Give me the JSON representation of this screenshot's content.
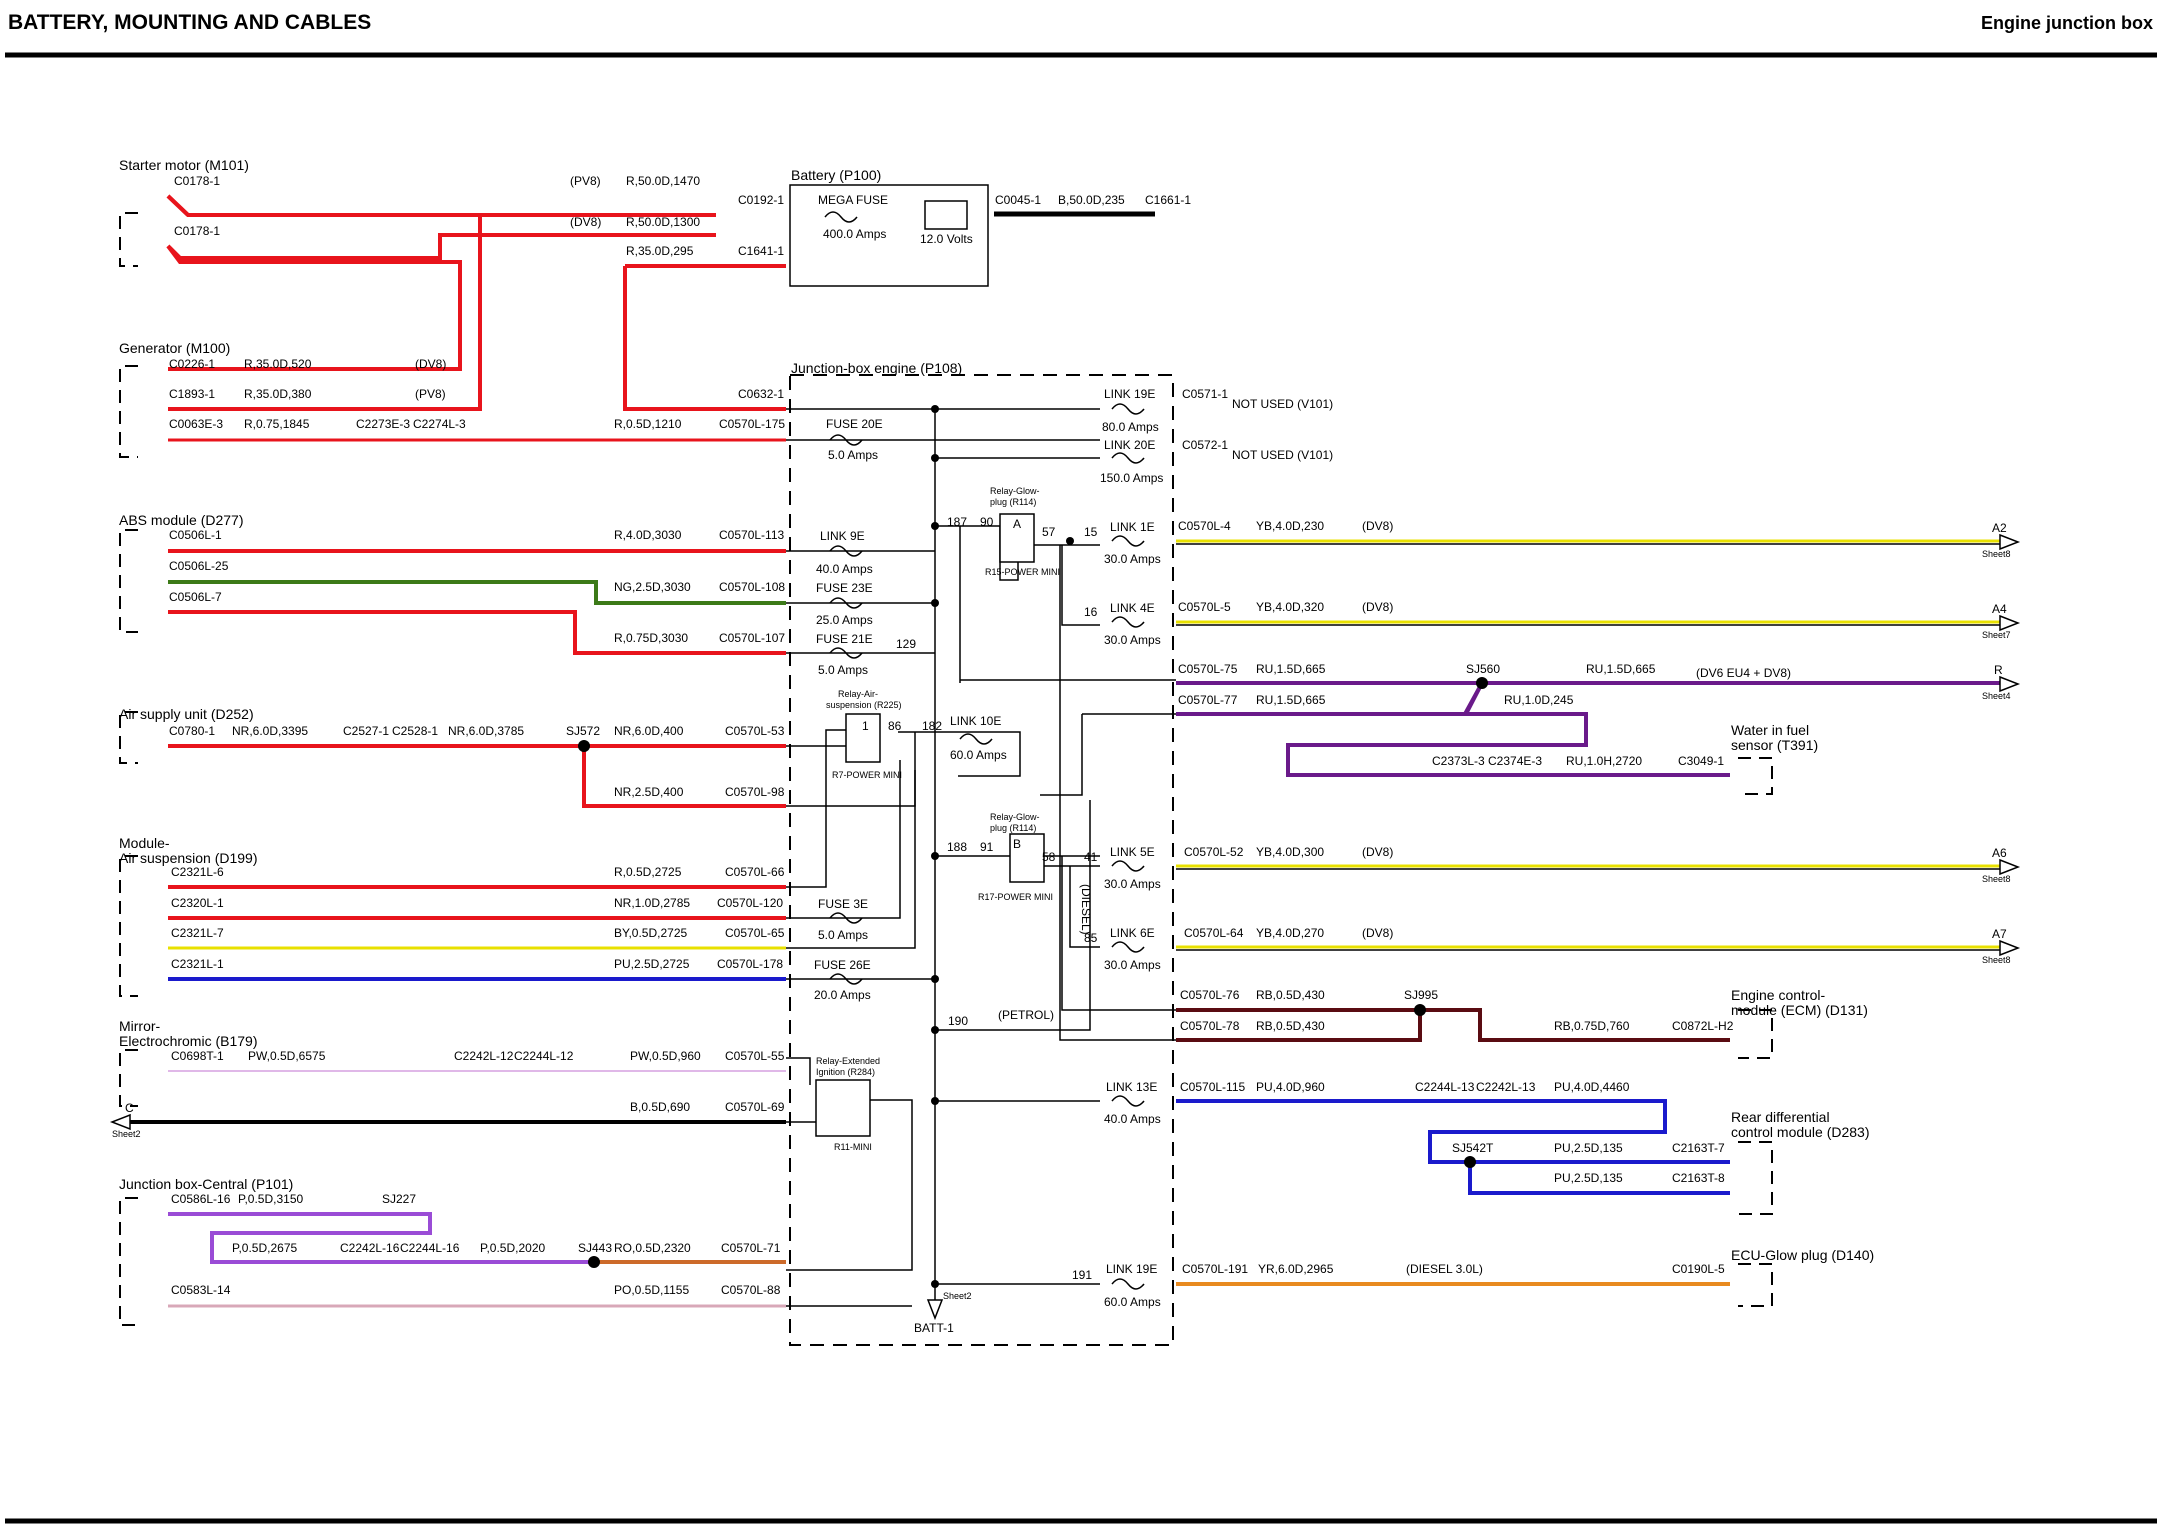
{
  "header": {
    "title": "BATTERY, MOUNTING AND CABLES",
    "subtitle": "Engine junction box"
  },
  "components": {
    "starter": "Starter motor (M101)",
    "generator": "Generator (M100)",
    "battery": "Battery (P100)",
    "jbox": "Junction-box engine (P108)",
    "abs": "ABS module (D277)",
    "air_supply": "Air supply unit (D252)",
    "module_air_1": "Module-",
    "module_air_2": "Air suspension (D199)",
    "mirror_1": "Mirror-",
    "mirror_2": "Electrochromic (B179)",
    "jb_central": "Junction box-Central (P101)",
    "water_1": "Water in fuel",
    "water_2": "sensor (T391)",
    "ecm_1": "Engine control-",
    "ecm_2": "module (ECM) (D131)",
    "rdiff_1": "Rear differential",
    "rdiff_2": "control module (D283)",
    "ecu_glow": "ECU-Glow plug (D140)"
  },
  "battery_box": {
    "fuse_label": "MEGA FUSE",
    "fuse_rating": "400.0 Amps",
    "voltage": "12.0 Volts"
  },
  "relays": {
    "glow_a_1": "Relay-Glow-",
    "glow_a_2": "plug (R114)",
    "glow_a_letter": "A",
    "glow_a_type": "R15-POWER MINI",
    "air_1": "Relay-Air-",
    "air_2": "suspension (R225)",
    "air_type": "R7-POWER MINI",
    "glow_b_1": "Relay-Glow-",
    "glow_b_2": "plug (R114)",
    "glow_b_letter": "B",
    "glow_b_type": "R17-POWER MINI",
    "ign_1": "Relay-Extended",
    "ign_2": "Ignition (R284)",
    "ign_type": "R11-MINI"
  },
  "fuses": {
    "link19e_a": {
      "name": "LINK 19E",
      "rating": "80.0 Amps"
    },
    "link20e": {
      "name": "LINK 20E",
      "rating": "150.0 Amps"
    },
    "fuse20e": {
      "name": "FUSE 20E",
      "rating": "5.0 Amps"
    },
    "link9e": {
      "name": "LINK 9E",
      "rating": "40.0 Amps"
    },
    "fuse23e": {
      "name": "FUSE 23E",
      "rating": "25.0 Amps"
    },
    "fuse21e": {
      "name": "FUSE 21E",
      "rating": "5.0 Amps"
    },
    "link1e": {
      "name": "LINK 1E",
      "rating": "30.0 Amps"
    },
    "link4e": {
      "name": "LINK 4E",
      "rating": "30.0 Amps"
    },
    "link10e": {
      "name": "LINK 10E",
      "rating": "60.0 Amps"
    },
    "link5e": {
      "name": "LINK 5E",
      "rating": "30.0 Amps"
    },
    "link6e": {
      "name": "LINK 6E",
      "rating": "30.0 Amps"
    },
    "fuse3e": {
      "name": "FUSE 3E",
      "rating": "5.0 Amps"
    },
    "fuse26e": {
      "name": "FUSE 26E",
      "rating": "20.0 Amps"
    },
    "link13e": {
      "name": "LINK 13E",
      "rating": "40.0 Amps"
    },
    "link19e_b": {
      "name": "LINK 19E",
      "rating": "60.0 Amps"
    }
  },
  "connectors": {
    "c0178_1a": "C0178-1",
    "c0178_1b": "C0178-1",
    "c0192": "C0192-1",
    "c1641": "C1641-1",
    "c0045": "C0045-1",
    "c1661": "C1661-1",
    "c0226": "C0226-1",
    "c1893": "C1893-1",
    "c0063e": "C0063E-3",
    "c2273e": "C2273E-3",
    "c2274l": "C2274L-3",
    "c0632": "C0632-1",
    "c0570_175": "C0570L-175",
    "c0571": "C0571-1",
    "c0572": "C0572-1",
    "c0506_1": "C0506L-1",
    "c0506_25": "C0506L-25",
    "c0506_7": "C0506L-7",
    "c0570_113": "C0570L-113",
    "c0570_108": "C0570L-108",
    "c0570_107": "C0570L-107",
    "c0570_4": "C0570L-4",
    "c0570_5": "C0570L-5",
    "c0570_75": "C0570L-75",
    "c0570_77": "C0570L-77",
    "c0780": "C0780-1",
    "c2527": "C2527-1",
    "c2528": "C2528-1",
    "c0570_53": "C0570L-53",
    "c0570_98": "C0570L-98",
    "c2373l": "C2373L-3",
    "c2374e": "C2374E-3",
    "c3049": "C3049-1",
    "c2321_6": "C2321L-6",
    "c2320_1": "C2320L-1",
    "c2321_7": "C2321L-7",
    "c2321_1": "C2321L-1",
    "c0570_66": "C0570L-66",
    "c0570_120": "C0570L-120",
    "c0570_65": "C0570L-65",
    "c0570_178": "C0570L-178",
    "c0570_52": "C0570L-52",
    "c0570_64": "C0570L-64",
    "c0570_76": "C0570L-76",
    "c0570_78": "C0570L-78",
    "c0872": "C0872L-H2",
    "c0698t": "C0698T-1",
    "c2242l_12": "C2242L-12",
    "c2244l_12": "C2244L-12",
    "c0570_55": "C0570L-55",
    "c0570_69": "C0570L-69",
    "c0570_115": "C0570L-115",
    "c2244l_13": "C2244L-13",
    "c2242l_13": "C2242L-13",
    "c2163t_7": "C2163T-7",
    "c2163t_8": "C2163T-8",
    "c0586": "C0586L-16",
    "c2242l_16": "C2242L-16",
    "c2244l_16": "C2244L-16",
    "c0570_71": "C0570L-71",
    "c0583": "C0583L-14",
    "c0570_88": "C0570L-88",
    "c0570_191": "C0570L-191",
    "c0190": "C0190L-5"
  },
  "wires": {
    "w1": "R,50.0D,1470",
    "w2": "R,50.0D,1300",
    "w3": "R,35.0D,295",
    "w4": "B,50.0D,235",
    "w5": "R,35.0D,520",
    "w6": "R,35.0D,380",
    "w7": "R,0.75,1845",
    "w8": "R,0.5D,1210",
    "w9": "R,4.0D,3030",
    "w10": "NG,2.5D,3030",
    "w11": "R,0.75D,3030",
    "w12": "YB,4.0D,230",
    "w13": "YB,4.0D,320",
    "w14": "RU,1.5D,665",
    "w15": "RU,1.5D,665",
    "w16": "RU,1.5D,665",
    "w17": "RU,1.0D,245",
    "w18": "RU,1.0H,2720",
    "w19": "NR,6.0D,3395",
    "w20": "NR,6.0D,3785",
    "w21": "NR,6.0D,400",
    "w22": "NR,2.5D,400",
    "w23": "R,0.5D,2725",
    "w24": "NR,1.0D,2785",
    "w25": "BY,0.5D,2725",
    "w26": "PU,2.5D,2725",
    "w27": "YB,4.0D,300",
    "w28": "YB,4.0D,270",
    "w29": "RB,0.5D,430",
    "w30": "RB,0.5D,430",
    "w31": "RB,0.75D,760",
    "w32": "PW,0.5D,6575",
    "w33": "PW,0.5D,960",
    "w34": "B,0.5D,690",
    "w35": "PU,4.0D,960",
    "w36": "PU,4.0D,4460",
    "w37": "PU,2.5D,135",
    "w38": "PU,2.5D,135",
    "w39": "P,0.5D,3150",
    "w40": "P,0.5D,2675",
    "w41": "P,0.5D,2020",
    "w42": "RO,0.5D,2320",
    "w43": "PO,0.5D,1155",
    "w44": "YR,6.0D,2965"
  },
  "variants": {
    "pv8_a": "(PV8)",
    "dv8_a": "(DV8)",
    "dv8_b": "(DV8)",
    "pv8_b": "(PV8)",
    "dv8_c": "(DV8)",
    "dv8_d": "(DV8)",
    "dv6": "(DV6 EU4 + DV8)",
    "dv8_e": "(DV8)",
    "dv8_f": "(DV8)",
    "diesel": "(DIESEL)",
    "petrol": "(PETROL)",
    "diesel30": "(DIESEL 3.0L)"
  },
  "splices": {
    "sj560": "SJ560",
    "sj572": "SJ572",
    "sj995": "SJ995",
    "sj542t": "SJ542T",
    "sj227": "SJ227",
    "sj443": "SJ443"
  },
  "not_used": {
    "a": "NOT USED (V101)",
    "b": "NOT USED (V101)"
  },
  "nodes": {
    "n187": "187",
    "n90": "90",
    "n57": "57",
    "n15": "15",
    "n16": "16",
    "n129": "129",
    "n1": "1",
    "n86": "86",
    "n182": "182",
    "n188": "188",
    "n91": "91",
    "n58": "58",
    "n41": "41",
    "n85": "85",
    "n190": "190",
    "n191": "191"
  },
  "offpage": {
    "a2": "A2",
    "s8a": "Sheet8",
    "a4": "A4",
    "s7": "Sheet7",
    "r": "R",
    "s4": "Sheet4",
    "a6": "A6",
    "s8b": "Sheet8",
    "a7": "A7",
    "s8c": "Sheet8",
    "c": "C",
    "s2": "Sheet2",
    "s2b": "Sheet2",
    "batt": "BATT-1"
  },
  "colors": {
    "red": "#e8141c",
    "green": "#3c7a18",
    "purple": "#6a1a8a",
    "violet": "#9a4cd6",
    "blue": "#1a1acc",
    "maroon": "#5a0c12",
    "orange": "#e88a20",
    "orange2": "#cc6a2a",
    "yellow": "#e8e000"
  }
}
